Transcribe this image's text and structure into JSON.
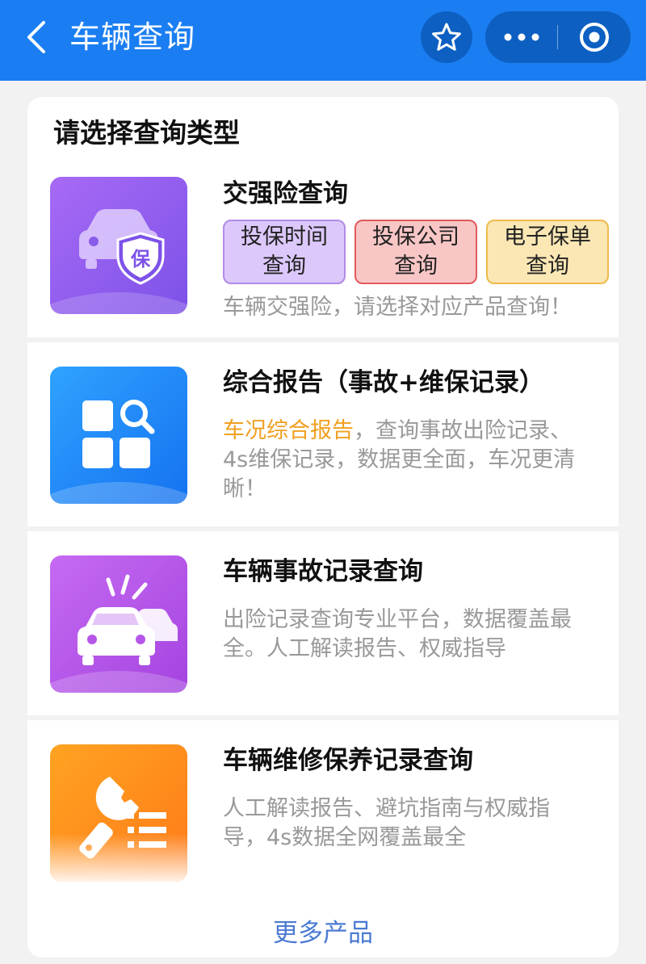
{
  "header": {
    "title": "车辆查询",
    "icons": {
      "back": "chevron-left-icon",
      "favorite": "star-icon",
      "more": "more-dots-icon",
      "close": "target-close-icon"
    }
  },
  "panel": {
    "title": "请选择查询类型",
    "items": [
      {
        "title": "交强险查询",
        "thumb_icon": "car-insurance-icon",
        "thumb_glyph": "保",
        "chips": [
          "投保时间查询",
          "投保公司查询",
          "电子保单查询"
        ],
        "desc": "车辆交强险，请选择对应产品查询！"
      },
      {
        "title": "综合报告（事故+维保记录）",
        "thumb_icon": "report-search-icon",
        "desc_highlight": "车况综合报告",
        "desc": "，查询事故出险记录、4s维保记录，数据更全面，车况更清晰！"
      },
      {
        "title": "车辆事故记录查询",
        "thumb_icon": "car-crash-icon",
        "desc": "出险记录查询专业平台，数据覆盖最全。人工解读报告、权威指导"
      },
      {
        "title": "车辆维修保养记录查询",
        "thumb_icon": "wrench-list-icon",
        "desc": "人工解读报告、避坑指南与权威指导，4s数据全网覆盖最全"
      }
    ],
    "more_label": "更多产品"
  },
  "colors": {
    "header_bg": "#1a7ef2",
    "accent_link": "#4b7bd3",
    "highlight": "#f0a020"
  }
}
